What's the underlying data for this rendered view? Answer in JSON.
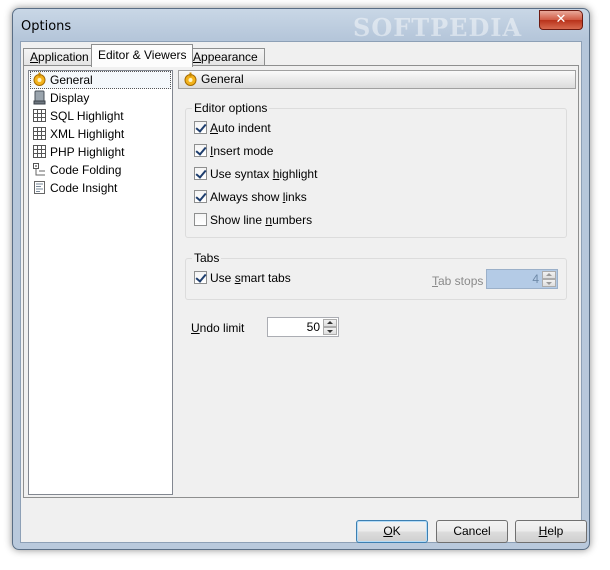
{
  "window": {
    "title": "Options",
    "close_glyph": "✕",
    "watermark": "SOFTPEDIA"
  },
  "tabs": [
    {
      "label": "Application",
      "accel_index": 0
    },
    {
      "label": "Editor & Viewers",
      "accel_index": 0
    },
    {
      "label": "Appearance",
      "accel_index": 0
    }
  ],
  "tree": {
    "items": [
      {
        "label": "General",
        "icon": "general-icon"
      },
      {
        "label": "Display",
        "icon": "display-icon"
      },
      {
        "label": "SQL Highlight",
        "icon": "grid-icon"
      },
      {
        "label": "XML Highlight",
        "icon": "grid-icon"
      },
      {
        "label": "PHP Highlight",
        "icon": "grid-icon"
      },
      {
        "label": "Code Folding",
        "icon": "code-folding-icon"
      },
      {
        "label": "Code Insight",
        "icon": "code-insight-icon"
      }
    ]
  },
  "panel": {
    "title": "General"
  },
  "editor_options": {
    "title": "Editor options",
    "auto_indent": {
      "pre": "",
      "acc": "A",
      "post": "uto indent",
      "checked": true
    },
    "insert_mode": {
      "pre": "",
      "acc": "I",
      "post": "nsert mode",
      "checked": true
    },
    "syntax_highlight": {
      "pre": "Use syntax ",
      "acc": "h",
      "post": "ighlight",
      "checked": true
    },
    "show_links": {
      "pre": "Always show ",
      "acc": "l",
      "post": "inks",
      "checked": true
    },
    "line_numbers": {
      "pre": "Show line ",
      "acc": "n",
      "post": "umbers",
      "checked": false
    }
  },
  "tabs_group": {
    "title": "Tabs",
    "smart_tabs": {
      "pre": "Use ",
      "acc": "s",
      "post": "mart tabs",
      "checked": true
    },
    "tab_stops_label_acc": "T",
    "tab_stops_label_rest": "ab stops",
    "tab_stops_value": "4"
  },
  "undo": {
    "label_acc": "U",
    "label_rest": "ndo limit",
    "value": "50"
  },
  "buttons": {
    "ok": {
      "acc": "O",
      "rest": "K"
    },
    "cancel": {
      "label": "Cancel"
    },
    "help": {
      "acc": "H",
      "rest": "elp"
    }
  }
}
